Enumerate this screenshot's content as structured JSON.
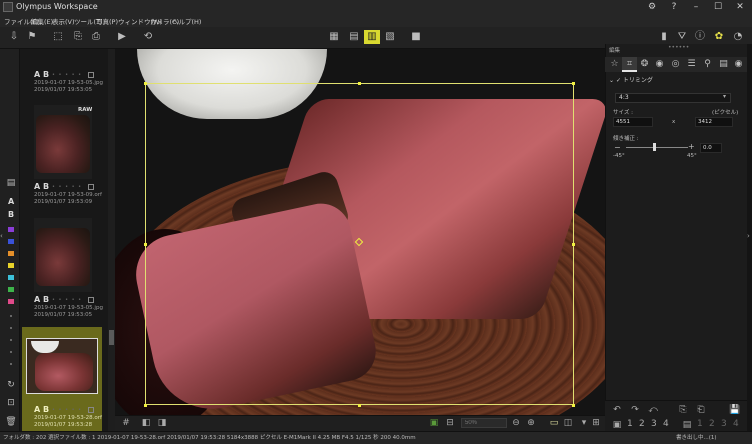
{
  "app": {
    "title": "Olympus Workspace"
  },
  "window_controls": {
    "settings": "⚙",
    "help": "?",
    "minimize": "–",
    "maximize": "☐",
    "close": "✕"
  },
  "menu": {
    "items": [
      "ファイル(F)",
      "編集(E)",
      "表示(V)",
      "ツール(T)",
      "写真(P)",
      "ウィンドウ(W)",
      "カメラ(C)",
      "ヘルプ(H)"
    ]
  },
  "thumbnails": [
    {
      "label": "A B",
      "file": "2019-01-07 19-53-05.jpg",
      "date": "2019/01/07 19:53:05",
      "badge": ""
    },
    {
      "label": "A B",
      "file": "2019-01-07 19-53-09.orf",
      "date": "2019/01/07 19:53:09",
      "badge": "RAW"
    },
    {
      "label": "A B",
      "file": "2019-01-07 19-53-05.jpg",
      "date": "2019/01/07 19:53:05",
      "badge": ""
    },
    {
      "label": "A B",
      "file": "2019-01-07 19-53-28.orf",
      "date": "2019/01/07 19:53:28",
      "badge": ""
    }
  ],
  "left_strip": {
    "ab": [
      "A",
      "B"
    ],
    "swatches": [
      "#8a3dd6",
      "#3a52d8",
      "#e6902a",
      "#e8d22a",
      "#3cc0d8",
      "#3db34a",
      "#e04a8a"
    ]
  },
  "right_panel": {
    "title": "編集",
    "dots": "••••••",
    "trim_label": "トリミング",
    "ratio_value": "4:3",
    "size_label": "サイズ :",
    "unit_label": "(ピクセル)",
    "width_value": "4551",
    "x_sep": "x",
    "height_value": "3412",
    "angle_label": "傾き補正 :",
    "angle_minus": "−",
    "angle_plus": "+",
    "angle_value": "0.0",
    "angle_min": "-45°",
    "angle_max": "45°",
    "bottom_nums": [
      "1",
      "2",
      "3",
      "4",
      "1",
      "2",
      "3",
      "4"
    ]
  },
  "viewer": {
    "zoom_placeholder": "50%"
  },
  "status": {
    "left": "フォルダ数 : 202   選択ファイル数 : 1   2019-01-07 19-53-28.orf   2019/01/07 19:53:28   5184x3888 ピクセル   E-M1Mark II   4.25 MB   F4.5   1/125 秒   200   40.0mm",
    "right": "書き出し中...(1)"
  }
}
